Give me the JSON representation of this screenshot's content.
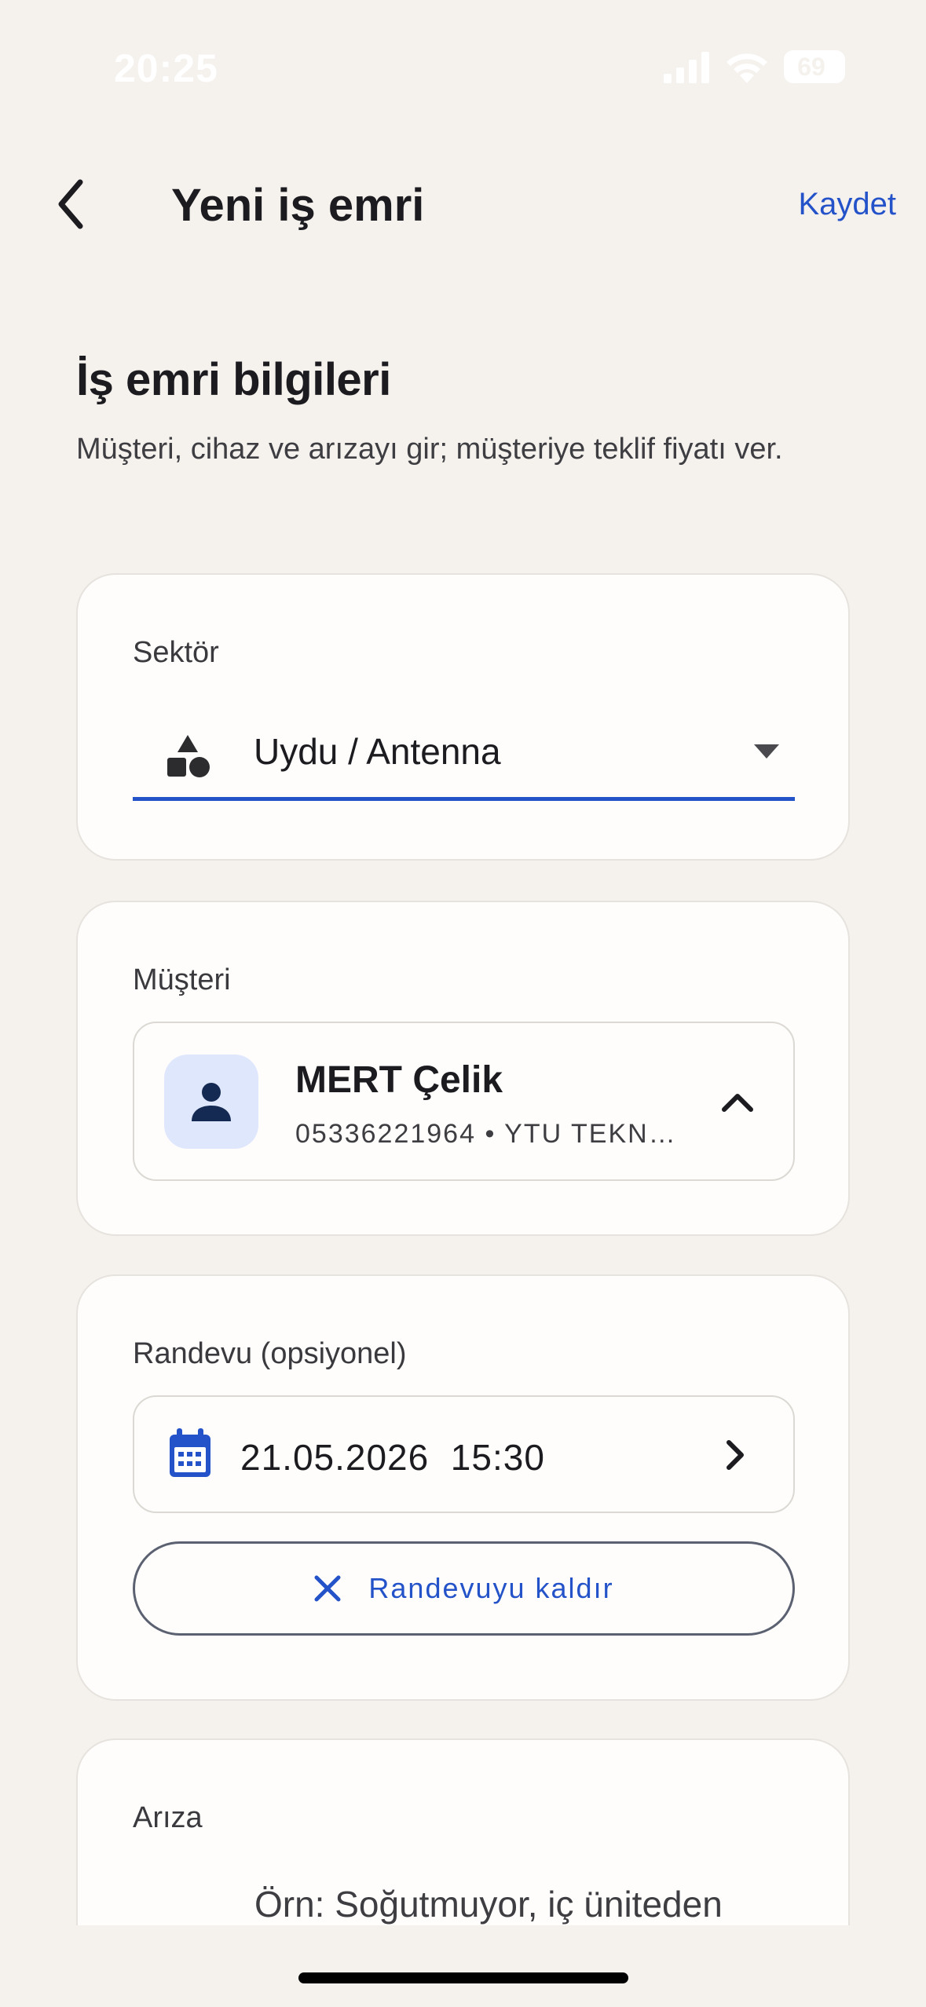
{
  "status_bar": {
    "time": "20:25",
    "battery": "69"
  },
  "header": {
    "title": "Yeni iş emri",
    "save_label": "Kaydet"
  },
  "section": {
    "title": "İş emri bilgileri",
    "description": "Müşteri, cihaz ve arızayı gir; müşteriye teklif fiyatı ver."
  },
  "sector": {
    "label": "Sektör",
    "value": "Uydu / Antenna"
  },
  "customer": {
    "label": "Müşteri",
    "name": "MERT Çelik",
    "details": "05336221964 • YTU TEKN…"
  },
  "appointment": {
    "label": "Randevu (opsiyonel)",
    "value": "21.05.2026  15:30",
    "remove_label": "Randevuyu kaldır"
  },
  "fault": {
    "label": "Arıza",
    "placeholder": "Örn: Soğutmuyor, iç üniteden"
  },
  "colors": {
    "accent": "#2352c9",
    "background": "#f5f2ee",
    "card": "#fefdfb",
    "avatar_bg": "#dfe7fd"
  }
}
